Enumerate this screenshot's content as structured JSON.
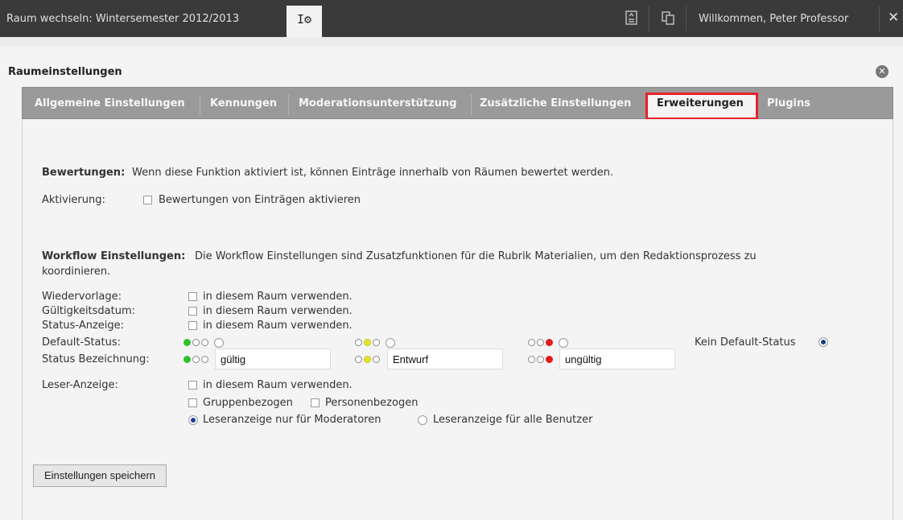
{
  "topbar": {
    "room_switch": "Raum wechseln: Wintersemester 2012/2013",
    "room_tab_icon": "settings-icon",
    "icon1": "document-list-icon",
    "icon2": "copy-icon",
    "welcome": "Willkommen, Peter Professor",
    "close": "✕"
  },
  "dialog": {
    "title": "Raumeinstellungen",
    "close_glyph": "✕"
  },
  "tabs": [
    {
      "label": "Allgemeine Einstellungen"
    },
    {
      "label": "Kennungen"
    },
    {
      "label": "Moderationsunterstützung"
    },
    {
      "label": "Zusätzliche Einstellungen"
    },
    {
      "label": "Erweiterungen",
      "active": true
    },
    {
      "label": "Plugins"
    }
  ],
  "ratings": {
    "heading": "Bewertungen:",
    "description": "Wenn diese Funktion aktiviert ist, können Einträge innerhalb von Räumen bewertet werden.",
    "activation_label": "Aktivierung:",
    "checkbox_label": "Bewertungen von Einträgen aktivieren",
    "checked": false
  },
  "workflow": {
    "heading": "Workflow Einstellungen:",
    "description_line1": "Die Workflow Einstellungen sind Zusatzfunktionen für die Rubrik Materialien, um den Redaktionsprozess zu",
    "description_line2": "koordinieren.",
    "resubmission_label": "Wiedervorlage:",
    "validity_label": "Gültigkeitsdatum:",
    "status_display_label": "Status-Anzeige:",
    "use_in_room": "in diesem Raum verwenden.",
    "default_status_label": "Default-Status:",
    "no_default_status": "Kein Default-Status",
    "status_names_label": "Status Bezeichnung:",
    "status_green": "gültig",
    "status_yellow": "Entwurf",
    "status_red": "ungültig",
    "colors": {
      "green": "#2fc12f",
      "yellow": "#e3e32b",
      "red": "#e01c1c"
    },
    "reader_label": "Leser-Anzeige:",
    "group_based": "Gruppenbezogen",
    "person_based": "Personenbezogen",
    "reader_moderators": "Leseranzeige nur für Moderatoren",
    "reader_all": "Leseranzeige für alle Benutzer"
  },
  "save_button": "Einstellungen speichern"
}
